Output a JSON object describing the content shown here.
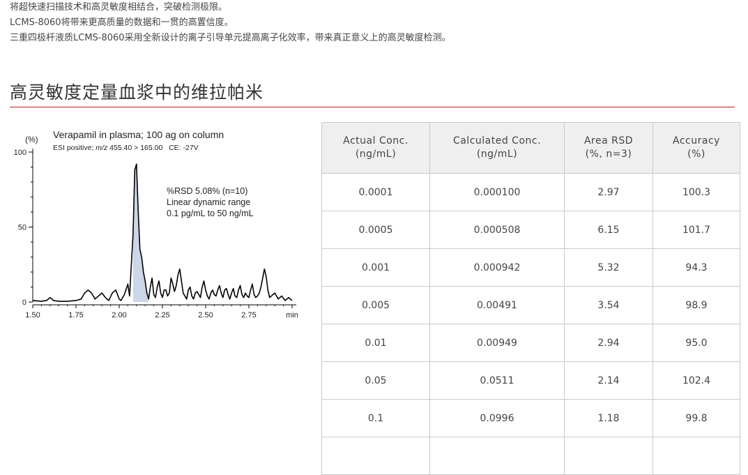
{
  "intro_lines": [
    "将超快速扫描技术和高灵敏度相结合，突破检测极限。",
    "LCMS-8060将带来更高质量的数据和一贯的高置信度。",
    "三重四极杆液质LCMS-8060采用全新设计的离子引导单元提高离子化效率，带来真正意义上的高灵敏度检测。"
  ],
  "section_title": "高灵敏度定量血浆中的维拉帕米",
  "chart": {
    "y_unit": "(%)",
    "title": "Verapamil in plasma; 100 ag on column",
    "subtitle_prefix": "ESI positive; ",
    "subtitle_mz": "m/z",
    "subtitle_suffix": " 455.40 > 165.00   CE: -27V",
    "annotation": [
      "%RSD 5.08% (n=10)",
      "Linear dynamic range",
      "0.1 pg/mL to 50 ng/mL"
    ],
    "x_unit": "min",
    "colors": {
      "fill": "#cbd6e8",
      "line": "#000000"
    }
  },
  "chart_data": {
    "type": "line",
    "title": "Verapamil in plasma; 100 ag on column",
    "xlabel": "min",
    "ylabel": "(%)",
    "xlim": [
      1.5,
      3.0
    ],
    "ylim": [
      0,
      100
    ],
    "x_ticks": [
      "1.50",
      "1.75",
      "2.00",
      "2.25",
      "2.50",
      "2.75",
      "min"
    ],
    "y_ticks": [
      "0",
      "50",
      "100"
    ],
    "grid": false,
    "series": [
      {
        "x": [
          1.5,
          1.55,
          1.58,
          1.6,
          1.62,
          1.65,
          1.7,
          1.75,
          1.78,
          1.8,
          1.82,
          1.84,
          1.86,
          1.88,
          1.9,
          1.92,
          1.94,
          1.96,
          1.98,
          2.0,
          2.01,
          2.03,
          2.05,
          2.06,
          2.08,
          2.09,
          2.1,
          2.11,
          2.12,
          2.13,
          2.14,
          2.15,
          2.16,
          2.17,
          2.18,
          2.19,
          2.2,
          2.21,
          2.22,
          2.23,
          2.24,
          2.25,
          2.26,
          2.27,
          2.28,
          2.29,
          2.3,
          2.31,
          2.32,
          2.33,
          2.34,
          2.35,
          2.36,
          2.37,
          2.38,
          2.39,
          2.4,
          2.41,
          2.42,
          2.43,
          2.44,
          2.45,
          2.46,
          2.47,
          2.48,
          2.49,
          2.5,
          2.51,
          2.52,
          2.53,
          2.54,
          2.55,
          2.56,
          2.57,
          2.58,
          2.59,
          2.6,
          2.61,
          2.62,
          2.63,
          2.64,
          2.65,
          2.66,
          2.67,
          2.68,
          2.69,
          2.7,
          2.71,
          2.72,
          2.73,
          2.74,
          2.75,
          2.76,
          2.77,
          2.78,
          2.79,
          2.8,
          2.81,
          2.82,
          2.83,
          2.84,
          2.85,
          2.86,
          2.87,
          2.88,
          2.9,
          2.92,
          2.94,
          2.96,
          2.98,
          3.0
        ],
        "values": [
          1,
          0.5,
          1,
          3,
          1,
          0.5,
          0.5,
          1,
          2,
          6,
          8,
          6,
          2,
          4,
          6,
          3,
          1,
          6,
          8,
          2,
          1,
          5,
          12,
          4,
          45,
          88,
          92,
          60,
          35,
          30,
          20,
          14,
          6,
          2,
          10,
          16,
          5,
          3,
          10,
          14,
          6,
          3,
          8,
          8,
          4,
          6,
          16,
          12,
          7,
          11,
          18,
          22,
          14,
          6,
          4,
          2,
          8,
          10,
          4,
          2,
          6,
          7,
          5,
          3,
          10,
          14,
          8,
          4,
          2,
          6,
          8,
          5,
          4,
          8,
          11,
          6,
          3,
          8,
          9,
          5,
          2,
          6,
          9,
          4,
          3,
          8,
          11,
          5,
          3,
          6,
          4,
          3,
          8,
          12,
          5,
          3,
          4,
          6,
          10,
          16,
          22,
          17,
          8,
          3,
          4,
          6,
          2,
          4,
          1,
          3,
          1
        ]
      }
    ]
  },
  "table": {
    "headers": [
      [
        "Actual Conc.",
        "(ng/mL)"
      ],
      [
        "Calculated Conc.",
        "(ng/mL)"
      ],
      [
        "Area RSD",
        "(%, n=3)"
      ],
      [
        "Accuracy",
        "(%)"
      ]
    ],
    "rows": [
      [
        "0.0001",
        "0.000100",
        "2.97",
        "100.3"
      ],
      [
        "0.0005",
        "0.000508",
        "6.15",
        "101.7"
      ],
      [
        "0.001",
        "0.000942",
        "5.32",
        "94.3"
      ],
      [
        "0.005",
        "0.00491",
        "3.54",
        "98.9"
      ],
      [
        "0.01",
        "0.00949",
        "2.94",
        "95.0"
      ],
      [
        "0.05",
        "0.0511",
        "2.14",
        "102.4"
      ],
      [
        "0.1",
        "0.0996",
        "1.18",
        "99.8"
      ],
      [
        "",
        "",
        "",
        ""
      ]
    ]
  }
}
